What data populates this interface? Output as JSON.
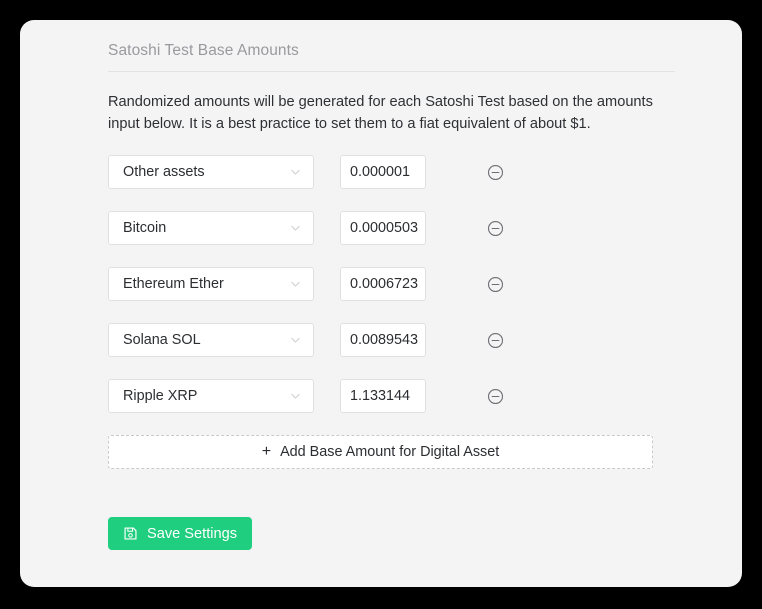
{
  "panel": {
    "section_title": "Satoshi Test Base Amounts",
    "description": "Randomized amounts will be generated for each Satoshi Test based on the amounts input below. It is a best practice to set them to a fiat equivalent of about $1."
  },
  "rows": [
    {
      "asset": "Other assets",
      "amount": "0.000001",
      "dropdown_icon": "chevron-down-icon",
      "remove_icon": "minus-circle-icon"
    },
    {
      "asset": "Bitcoin",
      "amount": "0.0000503",
      "dropdown_icon": "chevron-down-icon",
      "remove_icon": "minus-circle-icon"
    },
    {
      "asset": "Ethereum Ether",
      "amount": "0.0006723",
      "dropdown_icon": "chevron-down-icon",
      "remove_icon": "minus-circle-icon"
    },
    {
      "asset": "Solana SOL",
      "amount": "0.0089543",
      "dropdown_icon": "chevron-down-icon",
      "remove_icon": "minus-circle-icon"
    },
    {
      "asset": "Ripple XRP",
      "amount": "1.133144",
      "dropdown_icon": "chevron-down-icon",
      "remove_icon": "minus-circle-icon"
    }
  ],
  "actions": {
    "add_label": "Add Base Amount for Digital Asset",
    "add_plus": "+",
    "save_label": "Save Settings",
    "save_icon": "floppy-disk-icon"
  },
  "colors": {
    "accent_green": "#1fce7e",
    "panel_bg": "#f4f4f5",
    "title_gray": "#9a9a9e",
    "text_dark": "#2c2e31",
    "border_gray": "#e0e0e2"
  }
}
